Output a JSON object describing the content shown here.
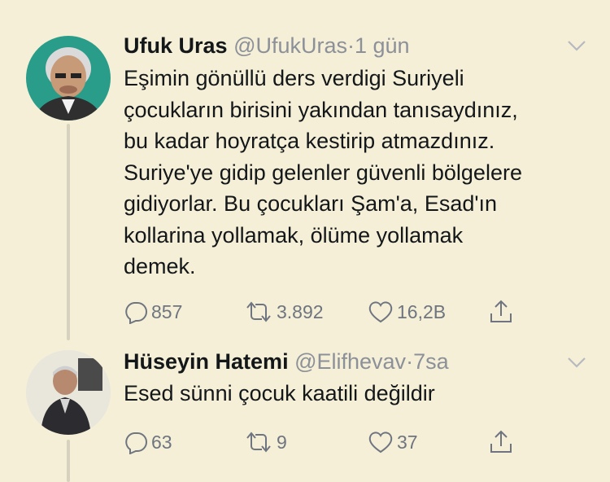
{
  "tweets": [
    {
      "name": "Ufuk Uras",
      "handle": "@UfukUras",
      "time": "1 gün",
      "text": "Eşimin gönüllü ders verdigi Suriyeli\nçocukların birisini yakından tanısaydınız,\nbu kadar hoyratça kestirip atmazdınız.\nSuriye'ye gidip gelenler güvenli bölgelere\ngidiyorlar. Bu çocukları Şam'a, Esad'ın\nkollarina yollamak, ölüme yollamak\ndemek.",
      "replies": "857",
      "retweets": "3.892",
      "likes": "16,2B"
    },
    {
      "name": "Hüseyin Hatemi",
      "handle": "@Elifhevav",
      "time": "7sa",
      "text": "Esed sünni çocuk kaatili değildir",
      "replies": "63",
      "retweets": "9",
      "likes": "37"
    }
  ],
  "separator": "·",
  "icons": {
    "reply": "reply-icon",
    "retweet": "retweet-icon",
    "like": "heart-icon",
    "share": "share-icon",
    "caret": "chevron-down-icon"
  },
  "colors": {
    "background": "#f4efd6",
    "text": "#14171a",
    "muted": "#8c9099",
    "icon": "#6f7580"
  }
}
